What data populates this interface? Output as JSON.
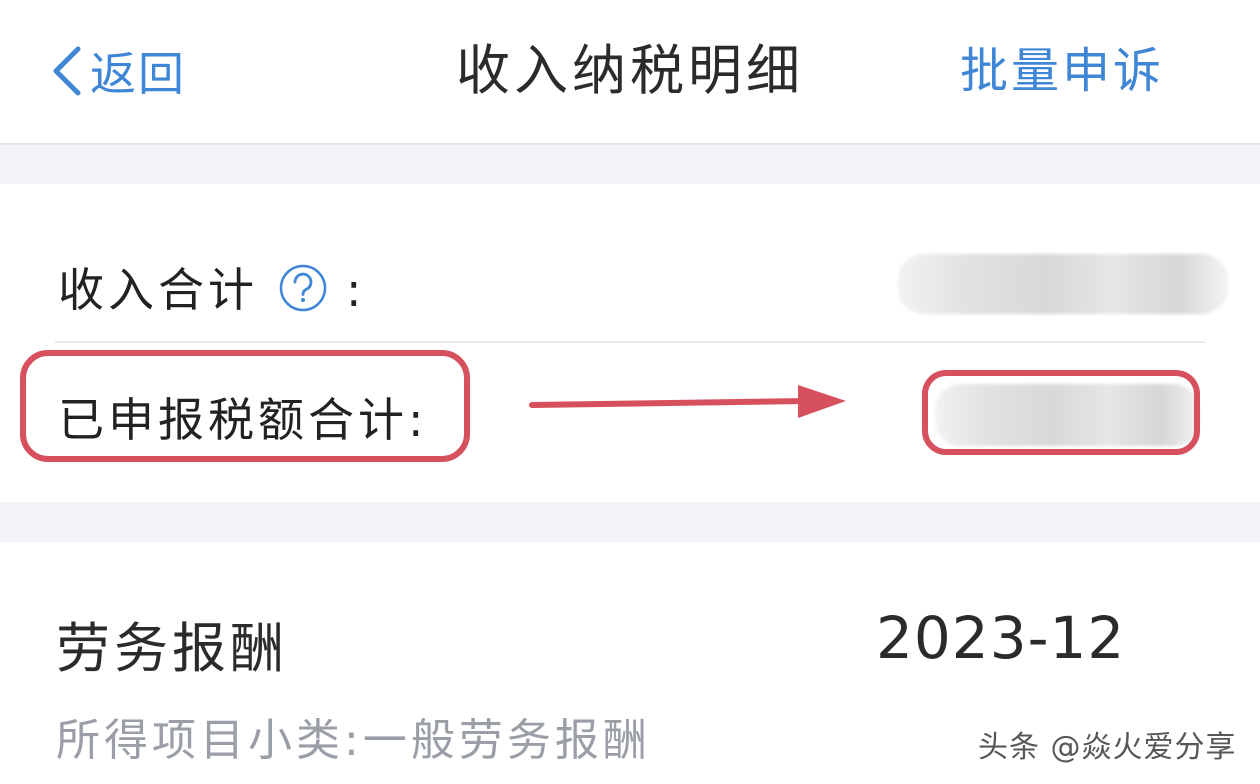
{
  "header": {
    "back_label": "返回",
    "title": "收入纳税明细",
    "batch_label": "批量申诉"
  },
  "summary": {
    "income_total_label": "收入合计",
    "colon": ":",
    "tax_declared_label": "已申报税额合计:",
    "income_total_value": "",
    "tax_declared_value": ""
  },
  "item": {
    "title": "劳务报酬",
    "date": "2023-12",
    "subcategory": "所得项目小类:一般劳务报酬"
  },
  "watermark": "头条 @焱火爱分享",
  "colors": {
    "accent": "#3f86d6",
    "highlight": "#d6505d",
    "background": "#f1f3f7"
  },
  "icons": {
    "back": "chevron-left-icon",
    "help": "question-circle-icon",
    "arrow": "arrow-right-icon"
  }
}
